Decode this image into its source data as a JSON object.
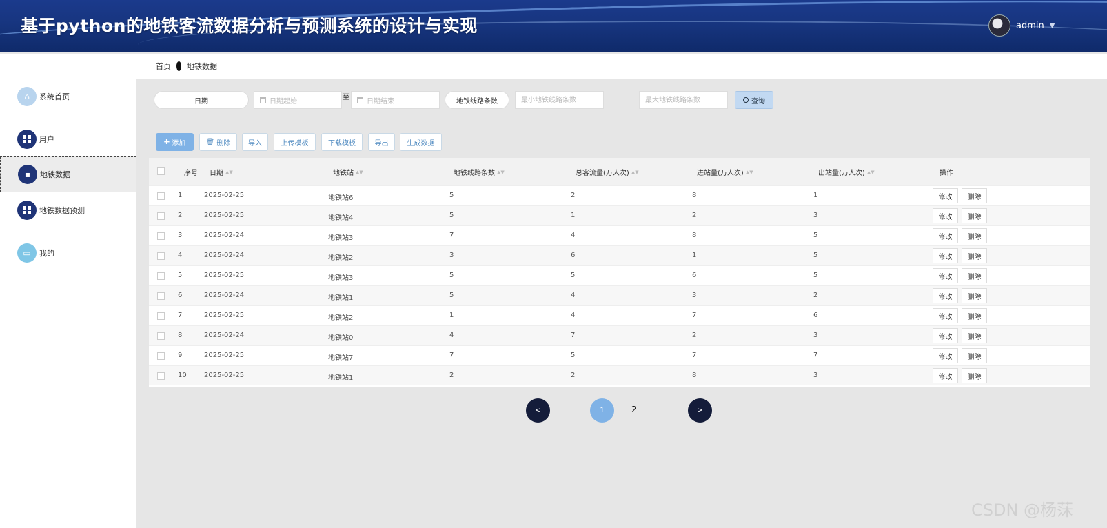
{
  "header": {
    "title": "基于python的地铁客流数据分析与预测系统的设计与实现",
    "username": "admin"
  },
  "breadcrumb": {
    "home": "首页",
    "current": "地铁数据"
  },
  "sidebar": {
    "items": [
      {
        "label": "系统首页",
        "icon": "home-icon"
      },
      {
        "label": "用户",
        "icon": "grid-icon"
      },
      {
        "label": "地铁数据",
        "icon": "clipboard-icon"
      },
      {
        "label": "地铁数据预测",
        "icon": "grid-icon"
      },
      {
        "label": "我的",
        "icon": "window-icon"
      }
    ]
  },
  "filters": {
    "date_label": "日期",
    "date_start_placeholder": "日期起始",
    "to_text": "至",
    "date_end_placeholder": "日期结束",
    "lines_label": "地铁线路条数",
    "min_lines_placeholder": "最小地铁线路条数",
    "max_lines_placeholder": "最大地铁线路条数",
    "search_label": "查询"
  },
  "toolbar": {
    "add": "添加",
    "delete": "删除",
    "import": "导入",
    "upload_template": "上传模板",
    "download_template": "下载模板",
    "export": "导出",
    "generate": "生成数据"
  },
  "table": {
    "headers": {
      "index": "序号",
      "date": "日期",
      "station": "地铁站",
      "lines": "地铁线路条数",
      "total": "总客流量(万人次)",
      "in": "进站量(万人次)",
      "out": "出站量(万人次)",
      "actions": "操作"
    },
    "edit_label": "修改",
    "delete_label": "删除",
    "rows": [
      {
        "index": "1",
        "date": "2025-02-25",
        "station": "地铁站6",
        "lines": "5",
        "total": "2",
        "in": "8",
        "out": "1"
      },
      {
        "index": "2",
        "date": "2025-02-25",
        "station": "地铁站4",
        "lines": "5",
        "total": "1",
        "in": "2",
        "out": "3"
      },
      {
        "index": "3",
        "date": "2025-02-24",
        "station": "地铁站3",
        "lines": "7",
        "total": "4",
        "in": "8",
        "out": "5"
      },
      {
        "index": "4",
        "date": "2025-02-24",
        "station": "地铁站2",
        "lines": "3",
        "total": "6",
        "in": "1",
        "out": "5"
      },
      {
        "index": "5",
        "date": "2025-02-25",
        "station": "地铁站3",
        "lines": "5",
        "total": "5",
        "in": "6",
        "out": "5"
      },
      {
        "index": "6",
        "date": "2025-02-24",
        "station": "地铁站1",
        "lines": "5",
        "total": "4",
        "in": "3",
        "out": "2"
      },
      {
        "index": "7",
        "date": "2025-02-25",
        "station": "地铁站2",
        "lines": "1",
        "total": "4",
        "in": "7",
        "out": "6"
      },
      {
        "index": "8",
        "date": "2025-02-24",
        "station": "地铁站0",
        "lines": "4",
        "total": "7",
        "in": "2",
        "out": "3"
      },
      {
        "index": "9",
        "date": "2025-02-25",
        "station": "地铁站7",
        "lines": "7",
        "total": "5",
        "in": "7",
        "out": "7"
      },
      {
        "index": "10",
        "date": "2025-02-25",
        "station": "地铁站1",
        "lines": "2",
        "total": "2",
        "in": "8",
        "out": "3"
      }
    ]
  },
  "pagination": {
    "prev": "<",
    "current": "1",
    "next_page": "2",
    "next": ">"
  },
  "watermark": "CSDN @杨莯"
}
